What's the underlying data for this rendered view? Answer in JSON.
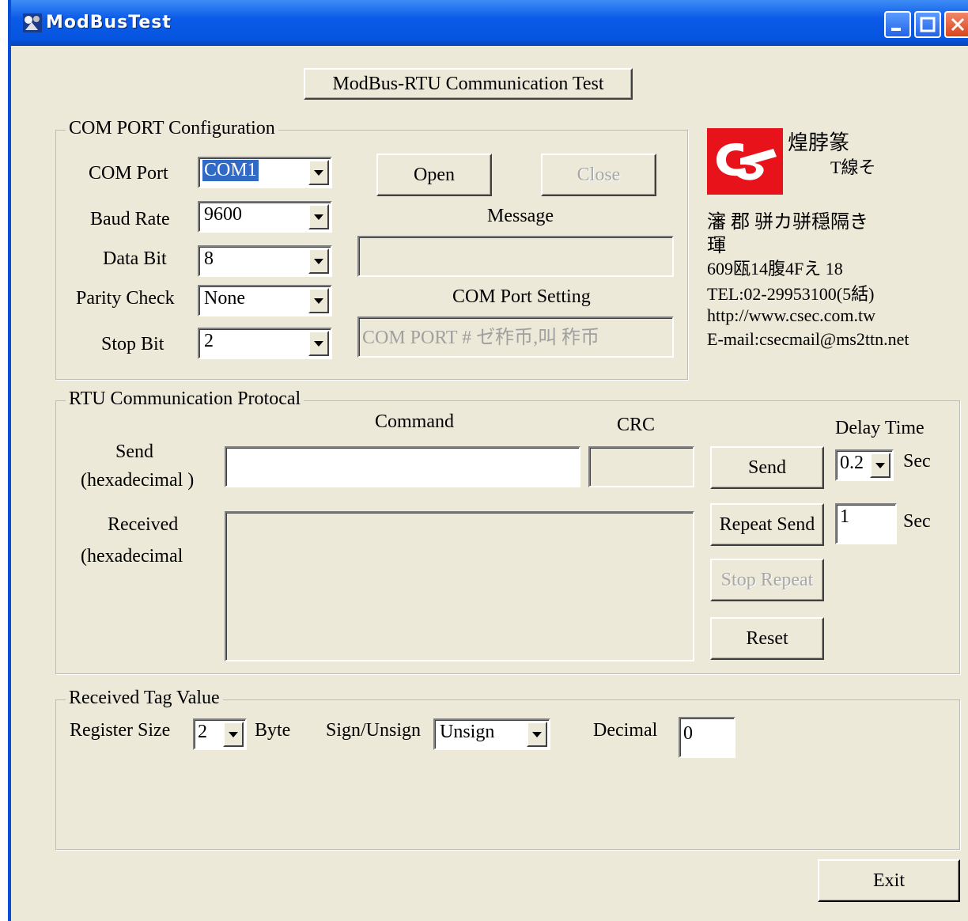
{
  "window": {
    "title": "ModBusTest"
  },
  "header_button": "ModBus-RTU Communication Test",
  "com_config": {
    "legend": "COM PORT Configuration",
    "com_port": {
      "label": "COM Port",
      "value": "COM1"
    },
    "baud_rate": {
      "label": "Baud Rate",
      "value": "9600"
    },
    "data_bit": {
      "label": "Data Bit",
      "value": "8"
    },
    "parity_check": {
      "label": "Parity Check",
      "value": "None"
    },
    "stop_bit": {
      "label": "Stop Bit",
      "value": "2"
    },
    "open_label": "Open",
    "close_label": "Close",
    "message_label": "Message",
    "message_value": "",
    "setting_label": "COM Port Setting",
    "setting_value": "COM PORT # ゼ秨币,叫    秨币"
  },
  "company": {
    "name": "煌脖篆",
    "subtitle": "T線そ",
    "line1": "瀋  郡  骈カ骈穏隔き",
    "line2": "琿",
    "address": "609瓯14腹4Fえ 18",
    "tel": "TEL:02-29953100(5絬)",
    "url": "http://www.csec.com.tw",
    "email": "E-mail:csecmail@ms2ttn.net",
    "logo_color": "#e8121b"
  },
  "rtu": {
    "legend": "RTU Communication Protocal",
    "command_label": "Command",
    "crc_label": "CRC",
    "delay_label": "Delay Time",
    "send_label_1": "Send",
    "send_label_2": "(hexadecimal )",
    "received_label_1": "Received",
    "received_label_2": "(hexadecimal",
    "command_value": "",
    "crc_value": "",
    "received_value": "",
    "send_button": "Send",
    "repeat_send_button": "Repeat Send",
    "stop_repeat_button": "Stop Repeat",
    "reset_button": "Reset",
    "delay_value": "0.2",
    "delay_unit": "Sec",
    "repeat_value": "1",
    "repeat_unit": "Sec"
  },
  "tag": {
    "legend": "Received Tag Value",
    "register_size_label": "Register Size",
    "register_size_value": "2",
    "byte_label": "Byte",
    "sign_label": "Sign/Unsign",
    "sign_value": "Unsign",
    "decimal_label": "Decimal",
    "decimal_value": "0"
  },
  "exit_button": "Exit",
  "colors": {
    "title_bar": "#0c5be8",
    "face": "#ece9d8",
    "selection": "#316ac5"
  }
}
